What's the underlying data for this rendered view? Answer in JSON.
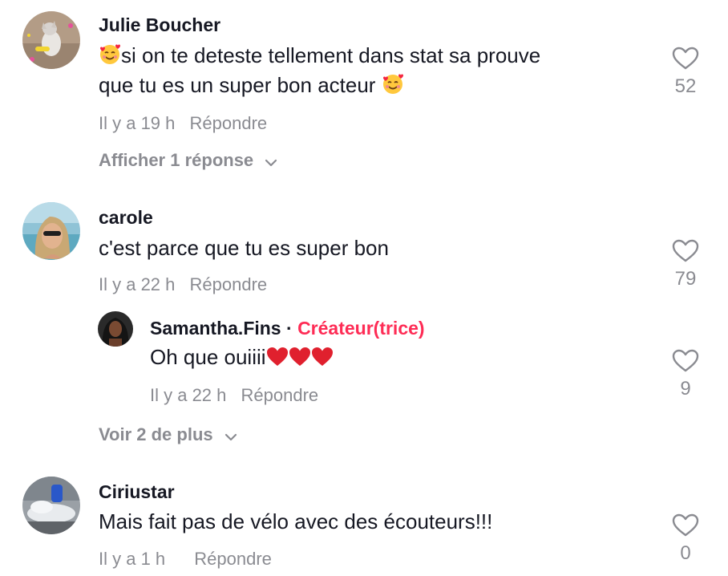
{
  "comments": [
    {
      "username": "Julie Boucher",
      "text_line1": "si on te deteste tellement dans stat sa prouve",
      "text_line2": "que tu es un super bon acteur",
      "time": "Il y a 19 h",
      "reply_label": "Répondre",
      "likes": "52",
      "more_label": "Afficher 1 réponse"
    },
    {
      "username": "carole",
      "text": "c'est parce que tu es super bon",
      "time": "Il y a 22 h",
      "reply_label": "Répondre",
      "likes": "79",
      "more_label": "Voir 2 de plus",
      "reply": {
        "username": "Samantha.Fins",
        "separator": "·",
        "creator_label": "Créateur(trice)",
        "text": "Oh que ouiiii",
        "time": "Il y a 22 h",
        "reply_label": "Répondre",
        "likes": "9"
      }
    },
    {
      "username": "Ciriustar",
      "text": "Mais fait pas de vélo avec des écouteurs!!!",
      "time": "Il y a 1 h",
      "reply_label": "Répondre",
      "likes": "0"
    }
  ],
  "icons": {
    "like": "heart-outline-icon",
    "expand": "chevron-down-icon",
    "emoji": "smiling-face-with-hearts-icon",
    "heart_emoji": "red-heart-icon"
  },
  "colors": {
    "text": "#161823",
    "muted": "#8a8b91",
    "creator": "#fe2c55",
    "heart_red": "#e0202e"
  }
}
